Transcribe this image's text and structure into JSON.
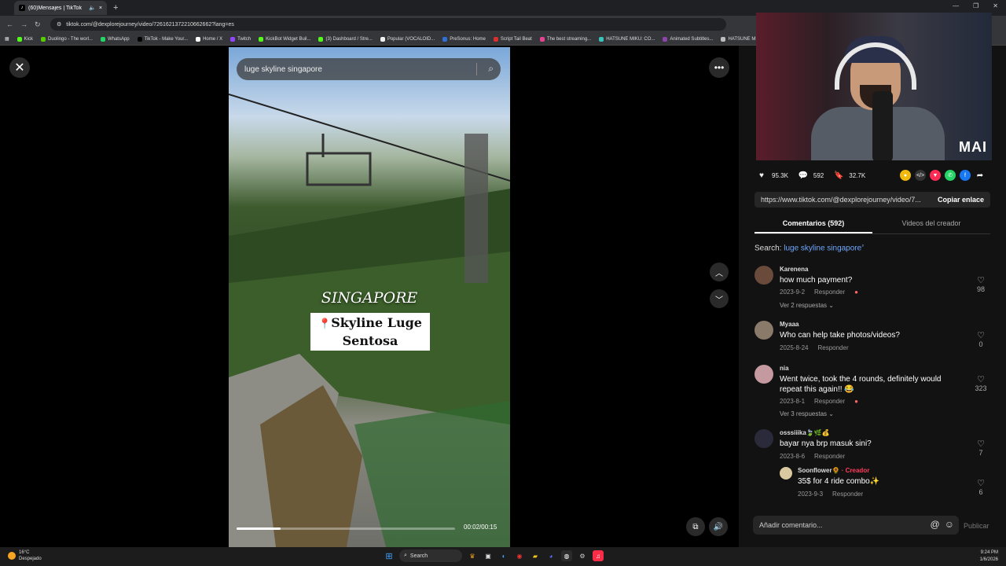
{
  "browser": {
    "tab_title": "(60)Mensajes | TikTok",
    "url": "tiktok.com/@dexplorejourney/video/7261621372210662662?lang=es",
    "bookmarks": [
      {
        "label": "Kick",
        "color": "#53fc18"
      },
      {
        "label": "Duolingo - The worl...",
        "color": "#58cc02"
      },
      {
        "label": "WhatsApp",
        "color": "#25d366"
      },
      {
        "label": "TikTok - Make Your...",
        "color": "#000000"
      },
      {
        "label": "Home / X",
        "color": "#ffffff"
      },
      {
        "label": "Twitch",
        "color": "#9146ff"
      },
      {
        "label": "KickBot Widget Buil...",
        "color": "#53fc18"
      },
      {
        "label": "(3) Dashboard / Stre...",
        "color": "#53fc18"
      },
      {
        "label": "Popular (VOCALOID...",
        "color": "#f0f0f0"
      },
      {
        "label": "PreSonus: Home",
        "color": "#2f6fd6"
      },
      {
        "label": "Script Tail Beat",
        "color": "#d63031"
      },
      {
        "label": "The best streaming...",
        "color": "#e84393"
      },
      {
        "label": "HATSUNE MIKU: CO...",
        "color": "#39c5bb"
      },
      {
        "label": "Animated Subtitles...",
        "color": "#8e44ad"
      },
      {
        "label": "HATSUNE MIKU",
        "color": "#bdbdbd"
      }
    ]
  },
  "video": {
    "search_query": "luge skyline singapore",
    "caption_title": "SINGAPORE",
    "caption_pin": "📍",
    "caption_line1": "Skyline Luge",
    "caption_line2": "Sentosa",
    "time": "00:02/00:15",
    "progress": 0.2
  },
  "stats": {
    "likes": "95.3K",
    "comments": "592",
    "saves": "32.7K"
  },
  "webcam_logo": "MAI",
  "link": {
    "url": "https://www.tiktok.com/@dexplorejourney/video/7...",
    "copy_label": "Copiar enlace"
  },
  "tabs": {
    "comments": "Comentarios (592)",
    "creator_videos": "Videos del creador"
  },
  "search_line": {
    "prefix": "Search:",
    "term": "luge skyline singapore"
  },
  "comments": [
    {
      "user": "Karenena",
      "text": "how much payment?",
      "date": "2023-9-2",
      "reply": "Responder",
      "likes": "98",
      "replies": "Ver 2 respuestas",
      "avatar": "#6a4a3a"
    },
    {
      "user": "Myaaa",
      "text": "Who can help take photos/videos?",
      "date": "2025-8-24",
      "reply": "Responder",
      "likes": "0",
      "avatar": "#8a7a6a"
    },
    {
      "user": "nia",
      "text": "Went twice, took the 4 rounds, definitely would repeat this again!! 😂",
      "date": "2023-8-1",
      "reply": "Responder",
      "likes": "323",
      "replies": "Ver 3 respuestas",
      "avatar": "#c49aa0"
    },
    {
      "user": "osssiiika🍃🌿💰",
      "text": "bayar nya brp masuk sini?",
      "date": "2023-8-6",
      "reply": "Responder",
      "likes": "7",
      "avatar": "#2a2a3a"
    }
  ],
  "reply": {
    "user": "Soonflower🌻",
    "badge": "· Creador",
    "text": "35$ for 4 ride combo✨",
    "date": "2023-9-3",
    "reply": "Responder",
    "likes": "6"
  },
  "composer": {
    "placeholder": "Añadir comentario...",
    "publish": "Publicar"
  },
  "taskbar": {
    "temp": "16°C",
    "weather": "Despejado",
    "search": "Search",
    "time": "9:24 PM",
    "date": "1/6/2026"
  }
}
